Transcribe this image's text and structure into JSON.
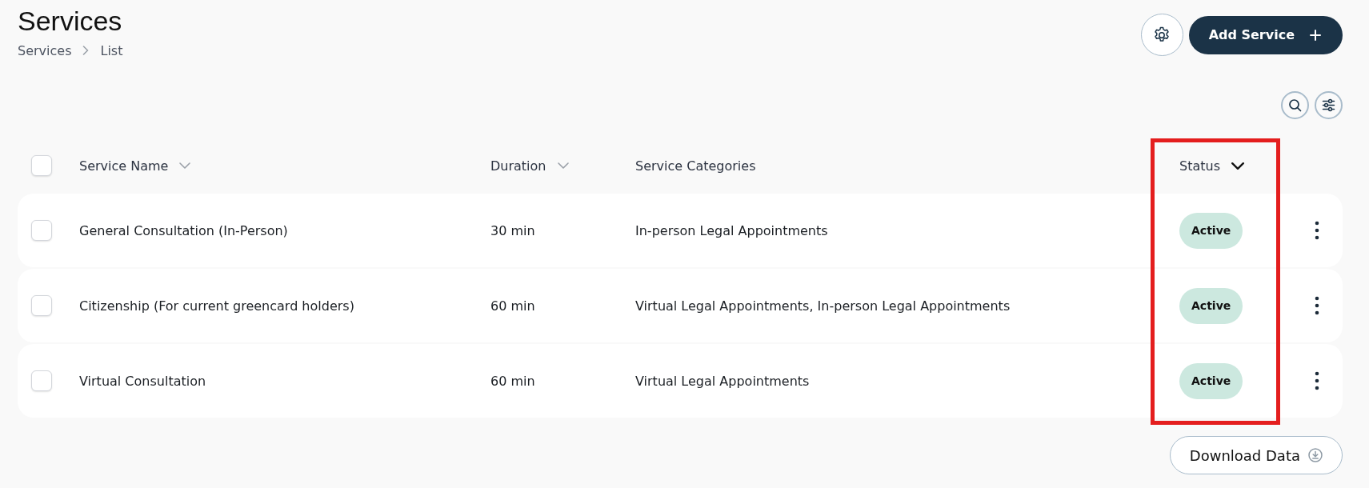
{
  "header": {
    "title": "Services",
    "breadcrumb": [
      {
        "label": "Services"
      },
      {
        "label": "List"
      }
    ],
    "add_button": {
      "label": "Add Service"
    }
  },
  "table": {
    "select_all": {
      "checked": false
    },
    "columns": [
      {
        "label": "Service Name",
        "sortable": true,
        "sorted": false,
        "highlighted": false
      },
      {
        "label": "Duration",
        "sortable": true,
        "sorted": false,
        "highlighted": false
      },
      {
        "label": "Service Categories",
        "sortable": false,
        "sorted": false,
        "highlighted": false
      },
      {
        "label": "Status",
        "sortable": true,
        "sorted": true,
        "highlighted": true
      }
    ],
    "rows": [
      {
        "checked": false,
        "name": "General Consultation (In-Person)",
        "duration": "30 min",
        "categories": "In-person Legal Appointments",
        "status": "Active"
      },
      {
        "checked": false,
        "name": "Citizenship (For current greencard holders)",
        "duration": "60 min",
        "categories": "Virtual Legal Appointments, In-person Legal Appointments",
        "status": "Active"
      },
      {
        "checked": false,
        "name": "Virtual Consultation",
        "duration": "60 min",
        "categories": "Virtual Legal Appointments",
        "status": "Active"
      }
    ]
  },
  "download_button": {
    "label": "Download Data"
  }
}
